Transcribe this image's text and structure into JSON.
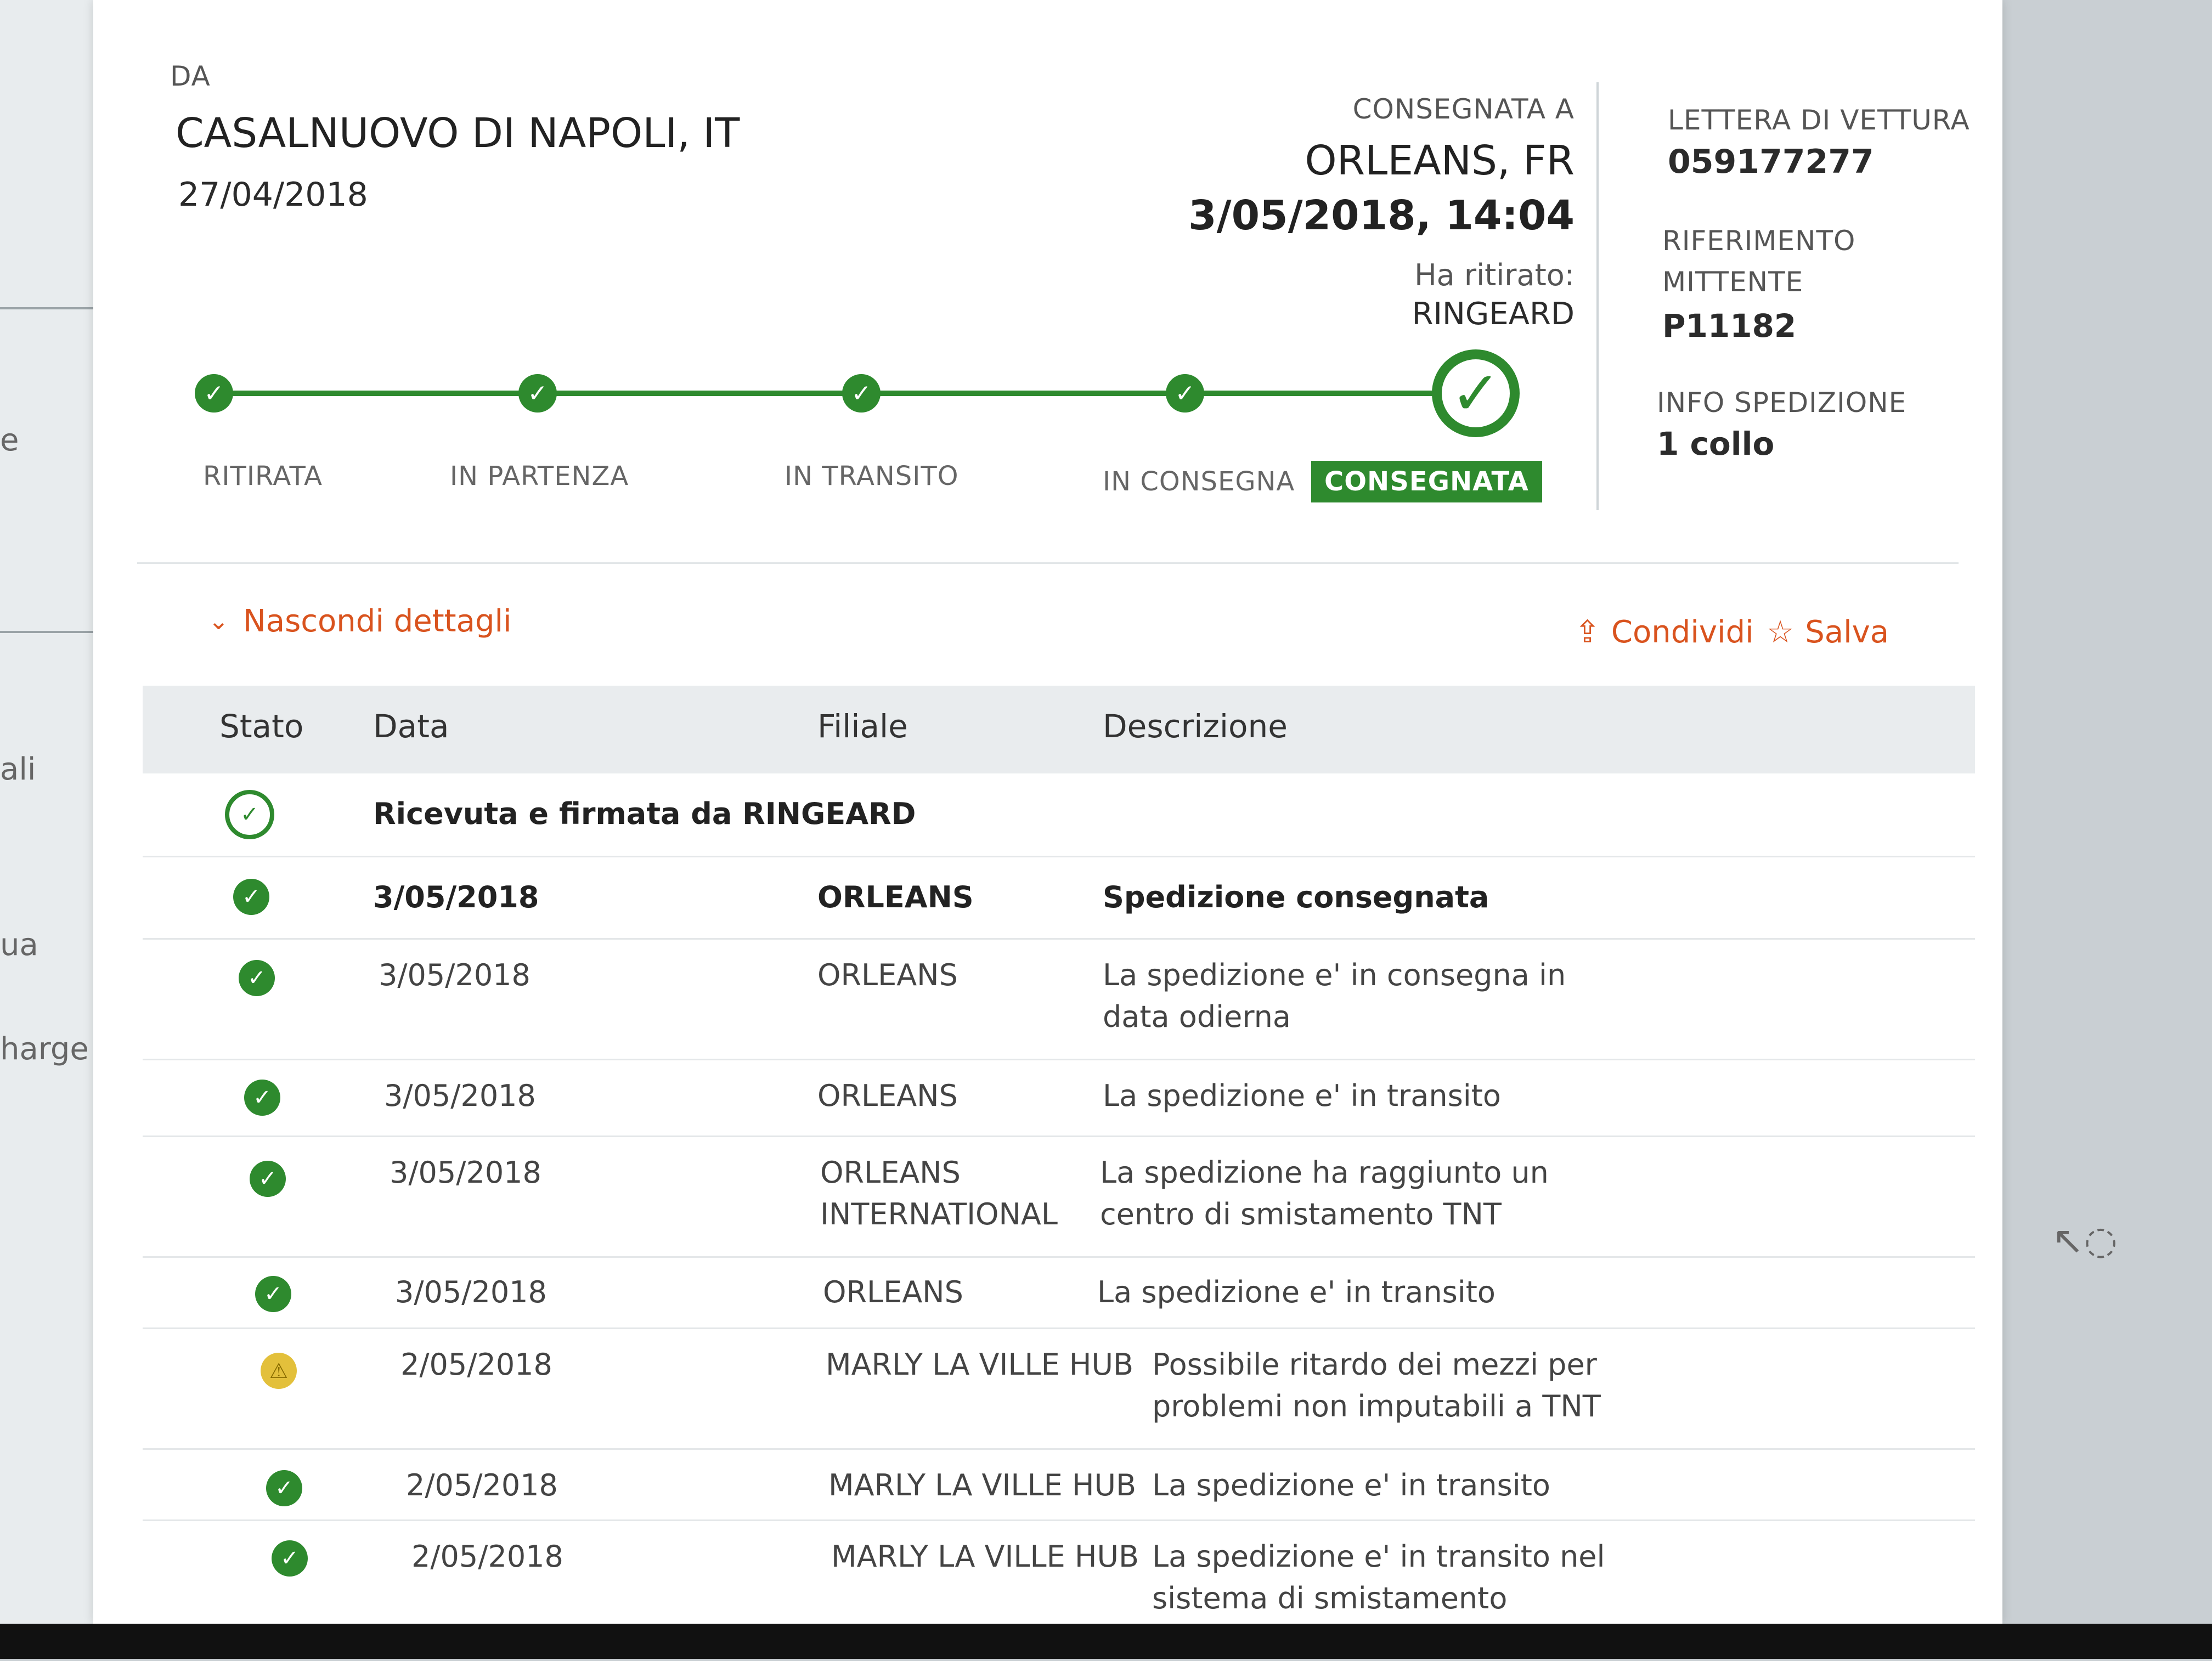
{
  "left_fragments": [
    "e",
    "ali",
    "ua",
    "harge"
  ],
  "origin": {
    "label": "DA",
    "city": "CASALNUOVO DI NAPOLI, IT",
    "date": "27/04/2018"
  },
  "delivery": {
    "label": "CONSEGNATA A",
    "city": "ORLEANS, FR",
    "datetime": "3/05/2018, 14:04",
    "picked_label": "Ha ritirato:",
    "picked_by": "RINGEARD"
  },
  "info": {
    "waybill_label": "LETTERA DI VETTURA",
    "waybill": "059177277",
    "ref_label_1": "RIFERIMENTO",
    "ref_label_2": "MITTENTE",
    "ref": "P11182",
    "ship_label": "INFO SPEDIZIONE",
    "ship": "1 collo"
  },
  "stages": [
    "RITIRATA",
    "IN PARTENZA",
    "IN TRANSITO",
    "IN CONSEGNA",
    "CONSEGNATA"
  ],
  "actions": {
    "toggle": "Nascondi dettagli",
    "share": "Condividi",
    "save": "Salva"
  },
  "table": {
    "headers": [
      "Stato",
      "Data",
      "Filiale",
      "Descrizione"
    ],
    "signed": "Ricevuta e firmata da RINGEARD",
    "rows": [
      {
        "status": "ok",
        "date": "3/05/2018",
        "branch": "ORLEANS",
        "desc": "Spedizione consegnata"
      },
      {
        "status": "ok",
        "date": "3/05/2018",
        "branch": "ORLEANS",
        "desc": "La spedizione e' in consegna in data odierna"
      },
      {
        "status": "ok",
        "date": "3/05/2018",
        "branch": "ORLEANS",
        "desc": "La spedizione e' in transito"
      },
      {
        "status": "ok",
        "date": "3/05/2018",
        "branch": "ORLEANS INTERNATIONAL",
        "desc": "La spedizione ha raggiunto un centro di smistamento TNT"
      },
      {
        "status": "ok",
        "date": "3/05/2018",
        "branch": "ORLEANS",
        "desc": "La spedizione e' in transito"
      },
      {
        "status": "warn",
        "date": "2/05/2018",
        "branch": "MARLY LA VILLE HUB",
        "desc": "Possibile ritardo dei mezzi per problemi non imputabili a TNT"
      },
      {
        "status": "ok",
        "date": "2/05/2018",
        "branch": "MARLY LA VILLE HUB",
        "desc": "La spedizione e' in transito"
      },
      {
        "status": "ok",
        "date": "2/05/2018",
        "branch": "MARLY LA VILLE HUB",
        "desc": "La spedizione e' in transito nel sistema di smistamento automatizzato"
      }
    ]
  },
  "colors": {
    "green": "#2e8a2e",
    "orange": "#d9531e",
    "warn": "#e3c03b"
  },
  "icons": {
    "check": "check-icon",
    "warning": "warning-icon",
    "share": "share-icon",
    "star": "star-icon",
    "chevron": "chevron-down-icon"
  }
}
